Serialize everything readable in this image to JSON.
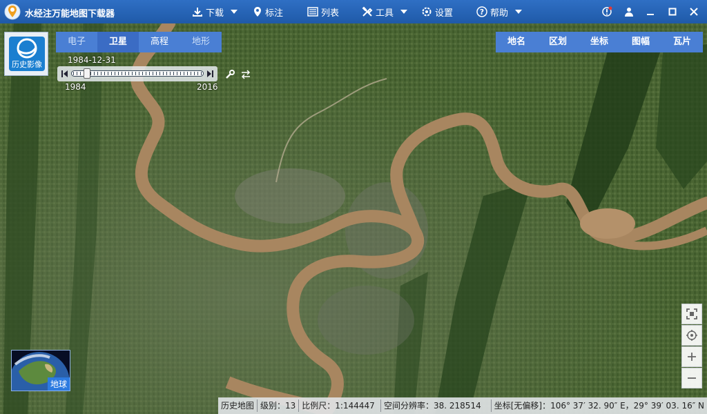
{
  "app": {
    "title": "水经注万能地图下载器"
  },
  "menu": {
    "download": "下载",
    "annotate": "标注",
    "list": "列表",
    "tools": "工具",
    "settings": "设置",
    "help": "帮助"
  },
  "history": {
    "label": "历史影像"
  },
  "map_types": [
    "电子",
    "卫星",
    "高程",
    "地形"
  ],
  "active_map_type": "卫星",
  "tools_tabs": [
    "地名",
    "区划",
    "坐标",
    "图幅",
    "瓦片"
  ],
  "timeline": {
    "current_date": "1984-12-31",
    "start_year": "1984",
    "end_year": "2016",
    "position": 0.12
  },
  "globe": {
    "label": "地球"
  },
  "status": {
    "mode": "历史地图",
    "level": "级别：13",
    "scale": "比例尺：1:144447",
    "resolution": "空间分辨率：38. 218514",
    "coords": "坐标[无偏移]：106° 37′ 32. 90″ E，29° 39′ 03. 16″ N"
  },
  "colors": {
    "titlebar": "#2a67b9",
    "tab_bar": "#4a7fd4",
    "river": "#b08a5e",
    "terrain": "#3e5a2c"
  },
  "icons": [
    "download-icon",
    "pin-icon",
    "list-icon",
    "tools-icon",
    "gear-icon",
    "help-icon",
    "notify-icon",
    "user-icon",
    "minimize-icon",
    "maximize-icon",
    "close-icon",
    "wrench-icon",
    "swap-icon",
    "fit-extent-icon",
    "locate-icon",
    "zoom-in-icon",
    "zoom-out-icon"
  ]
}
